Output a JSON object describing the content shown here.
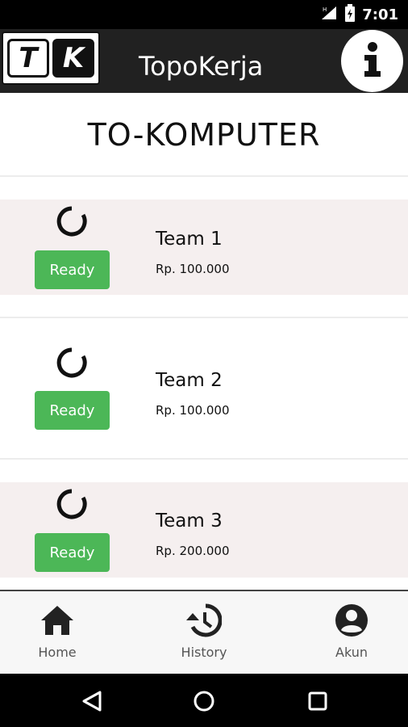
{
  "status_bar": {
    "time": "7:01"
  },
  "app_bar": {
    "logo_letters": [
      "T",
      "K"
    ],
    "title": "TopoKerja"
  },
  "page": {
    "title": "TO-KOMPUTER"
  },
  "teams": [
    {
      "name": "Team 1",
      "price": "Rp. 100.000",
      "button_label": "Ready"
    },
    {
      "name": "Team 2",
      "price": "Rp. 100.000",
      "button_label": "Ready"
    },
    {
      "name": "Team 3",
      "price": "Rp. 200.000",
      "button_label": "Ready"
    }
  ],
  "bottom_nav": {
    "items": [
      {
        "label": "Home",
        "icon": "home-icon"
      },
      {
        "label": "History",
        "icon": "history-icon"
      },
      {
        "label": "Akun",
        "icon": "account-circle-icon"
      }
    ]
  },
  "colors": {
    "app_bar": "#212121",
    "ready_button": "#4cb757",
    "card_shade": "#f5efef"
  }
}
